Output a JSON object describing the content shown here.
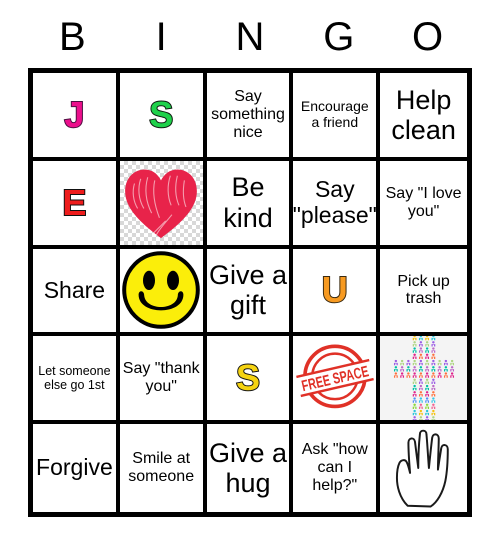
{
  "header": {
    "letters": [
      "B",
      "I",
      "N",
      "G",
      "O"
    ]
  },
  "grid": {
    "rows": [
      [
        {
          "kind": "letter",
          "text": "J",
          "color": "#ec0f8c",
          "name": "bingo-letter-j"
        },
        {
          "kind": "letter",
          "text": "S",
          "color": "#1fd14b",
          "name": "bingo-letter-s-green"
        },
        {
          "kind": "text",
          "text": "Say something nice",
          "size": "fs-md",
          "name": "cell-say-something-nice"
        },
        {
          "kind": "text",
          "text": "Encourage a friend",
          "size": "fs-sm",
          "name": "cell-encourage-a-friend"
        },
        {
          "kind": "text",
          "text": "Help clean",
          "size": "fs-xl",
          "name": "cell-help-clean"
        }
      ],
      [
        {
          "kind": "letter",
          "text": "E",
          "color": "#ee1c1c",
          "name": "bingo-letter-e"
        },
        {
          "kind": "image",
          "icon": "heart-icon",
          "name": "cell-heart-image"
        },
        {
          "kind": "text",
          "text": "Be kind",
          "size": "fs-xl",
          "name": "cell-be-kind"
        },
        {
          "kind": "text",
          "text": "Say \"please\"",
          "size": "fs-lg",
          "name": "cell-say-please"
        },
        {
          "kind": "text",
          "text": "Say \"I love you\"",
          "size": "fs-md",
          "name": "cell-say-i-love-you"
        }
      ],
      [
        {
          "kind": "text",
          "text": "Share",
          "size": "fs-lg",
          "name": "cell-share"
        },
        {
          "kind": "image",
          "icon": "smiley-face-icon",
          "name": "cell-smiley-image"
        },
        {
          "kind": "text",
          "text": "Give a gift",
          "size": "fs-xl",
          "name": "cell-give-a-gift"
        },
        {
          "kind": "letter",
          "text": "U",
          "color": "#f79a21",
          "name": "bingo-letter-u"
        },
        {
          "kind": "text",
          "text": "Pick up trash",
          "size": "fs-md",
          "name": "cell-pick-up-trash"
        }
      ],
      [
        {
          "kind": "text",
          "text": "Let someone else go 1st",
          "size": "fs-xs",
          "name": "cell-let-someone-else-go-1st"
        },
        {
          "kind": "text",
          "text": "Say \"thank you\"",
          "size": "fs-md",
          "name": "cell-say-thank-you"
        },
        {
          "kind": "letter",
          "text": "S",
          "color": "#f5d311",
          "name": "bingo-letter-s-gold"
        },
        {
          "kind": "image",
          "icon": "free-space-stamp-icon",
          "name": "cell-free-space",
          "stamp_text": "FREE SPACE"
        },
        {
          "kind": "image",
          "icon": "people-cross-icon",
          "name": "cell-cross-image"
        }
      ],
      [
        {
          "kind": "text",
          "text": "Forgive",
          "size": "fs-lg",
          "name": "cell-forgive"
        },
        {
          "kind": "text",
          "text": "Smile at someone",
          "size": "fs-md",
          "name": "cell-smile-at-someone"
        },
        {
          "kind": "text",
          "text": "Give a hug",
          "size": "fs-xl",
          "name": "cell-give-a-hug"
        },
        {
          "kind": "text",
          "text": "Ask \"how can I help?\"",
          "size": "fs-md",
          "name": "cell-ask-how-can-i-help"
        },
        {
          "kind": "image",
          "icon": "open-hand-icon",
          "name": "cell-hand-image"
        }
      ]
    ]
  },
  "colors": {
    "border": "#000000",
    "background": "#ffffff",
    "heart": "#e8234a",
    "smiley": "#fbee0a",
    "stamp": "#e03127",
    "letter_j": "#ec0f8c",
    "letter_s_green": "#1fd14b",
    "letter_e": "#ee1c1c",
    "letter_u": "#f79a21",
    "letter_s_gold": "#f5d311"
  }
}
